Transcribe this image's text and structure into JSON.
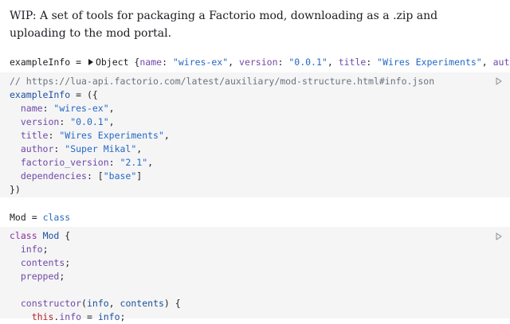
{
  "intro": {
    "text": "WIP: A set of tools for packaging a Factorio mod, downloading as a .zip and uploading to the mod portal."
  },
  "output1": {
    "name": "exampleInfo",
    "eq": " = ",
    "type": "Object",
    "open": " {",
    "k1": "name",
    "v1": "\"wires-ex\"",
    "k2": "version",
    "v2": "\"0.0.1\"",
    "k3": "title",
    "v3": "\"Wires Experiments\"",
    "k4": "author",
    "v4": "\""
  },
  "cell1": {
    "comment": "// https://lua-api.factorio.com/latest/auxiliary/mod-structure.html#info.json",
    "decl": "exampleInfo",
    "decl_rest": " = ({",
    "fields": [
      {
        "key": "name",
        "val": "\"wires-ex\"",
        "end": ","
      },
      {
        "key": "version",
        "val": "\"0.0.1\"",
        "end": ","
      },
      {
        "key": "title",
        "val": "\"Wires Experiments\"",
        "end": ","
      },
      {
        "key": "author",
        "val": "\"Super Mikal\"",
        "end": ","
      },
      {
        "key": "factorio_version",
        "val": "\"2.1\"",
        "end": ","
      }
    ],
    "dep_key": "dependencies",
    "dep_open": ": [",
    "dep_val": "\"base\"",
    "dep_close": "]",
    "close": "})"
  },
  "output2": {
    "name": "Mod",
    "eq": " = ",
    "value": "class"
  },
  "cell2": {
    "kw_class": "class",
    "class_name": "Mod",
    "open": " {",
    "fields": [
      "info",
      "contents",
      "prepped"
    ],
    "ctor": "constructor",
    "p1": "info",
    "p2": "contents",
    "ctor_end": ") {",
    "this": "this",
    "assign_prop": "info",
    "assign_val": "info",
    "semi": ";"
  }
}
